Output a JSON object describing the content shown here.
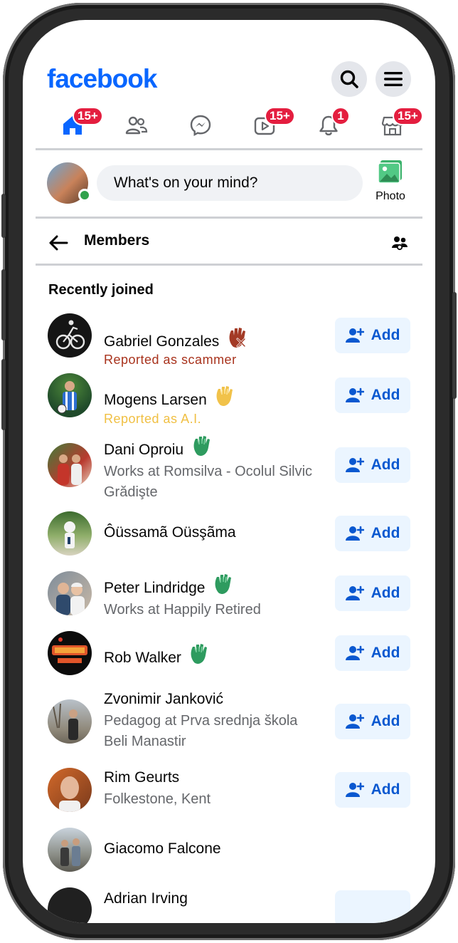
{
  "app": {
    "logo": "facebook"
  },
  "nav": {
    "badges": {
      "home": "15+",
      "watch": "15+",
      "notifications": "1",
      "marketplace": "15+"
    }
  },
  "composer": {
    "placeholder": "What's on your mind?",
    "photo_label": "Photo"
  },
  "members_page": {
    "title": "Members",
    "section_title": "Recently joined"
  },
  "members": [
    {
      "name": "Gabriel Gonzales",
      "subtitle": "Reported as scammer",
      "add_label": "Add",
      "wave": "red"
    },
    {
      "name": "Mogens Larsen",
      "subtitle": "Reported as A.I.",
      "add_label": "Add",
      "wave": "yellow"
    },
    {
      "name": "Dani Oproiu",
      "subtitle": "Works at Romsilva - Ocolul Silvic Grădişte",
      "add_label": "Add",
      "wave": "green"
    },
    {
      "name": "Ôüssamã Oüsşãma",
      "subtitle": "",
      "add_label": "Add",
      "wave": ""
    },
    {
      "name": "Peter Lindridge",
      "subtitle": "Works at Happily Retired",
      "add_label": "Add",
      "wave": "green"
    },
    {
      "name": "Rob Walker",
      "subtitle": "",
      "add_label": "Add",
      "wave": "green"
    },
    {
      "name": "Zvonimir Janković",
      "subtitle": "Pedagog at Prva srednja škola Beli Manastir",
      "add_label": "Add",
      "wave": ""
    },
    {
      "name": "Rim Geurts",
      "subtitle": "Folkestone, Kent",
      "add_label": "Add",
      "wave": ""
    },
    {
      "name": "Giacomo Falcone",
      "subtitle": "",
      "add_label": "",
      "wave": ""
    },
    {
      "name": "Adrian Irving",
      "subtitle": "",
      "add_label": "",
      "wave": ""
    }
  ],
  "colors": {
    "brand": "#0866ff",
    "badge": "#e41e3f",
    "scam_text": "#a8321c",
    "ai_text": "#f0bf42",
    "wave_green": "#2e9b5f",
    "add_bg": "#ebf5ff",
    "add_text": "#0a58d0"
  },
  "icons": {
    "search": "search-icon",
    "menu": "menu-icon",
    "home": "home-icon",
    "friends": "friends-icon",
    "messenger": "messenger-icon",
    "watch": "watch-icon",
    "notifications": "bell-icon",
    "marketplace": "marketplace-icon",
    "back": "back-arrow-icon",
    "members_settings": "people-icon",
    "add_friend": "add-friend-icon"
  }
}
